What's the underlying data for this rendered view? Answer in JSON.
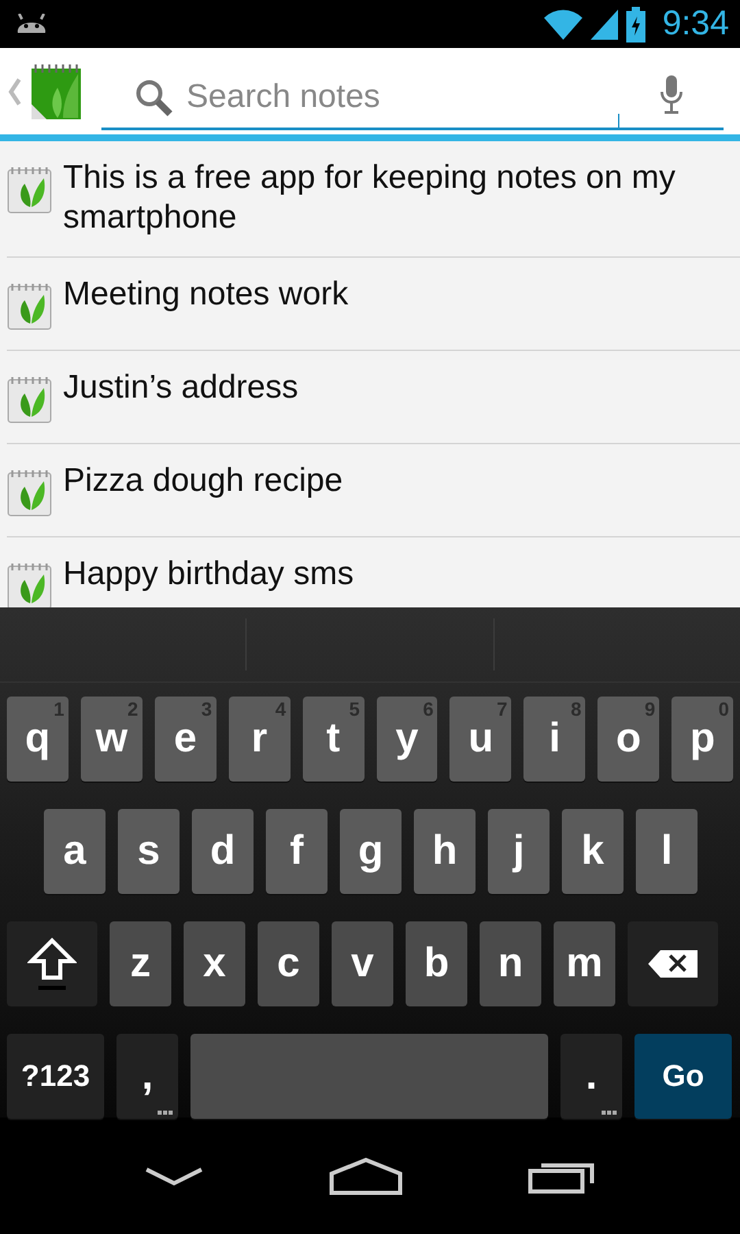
{
  "status_bar": {
    "time": "9:34"
  },
  "search": {
    "placeholder": "Search notes"
  },
  "notes": [
    {
      "title": "This is a free app for keeping notes on my smartphone"
    },
    {
      "title": "Meeting notes work"
    },
    {
      "title": "Justin’s address"
    },
    {
      "title": "Pizza dough recipe"
    },
    {
      "title": "Happy birthday sms"
    }
  ],
  "keyboard": {
    "key_rows": [
      {
        "keys": [
          {
            "kind": "letter",
            "label": "q",
            "hint": "1"
          },
          {
            "kind": "letter",
            "label": "w",
            "hint": "2"
          },
          {
            "kind": "letter",
            "label": "e",
            "hint": "3"
          },
          {
            "kind": "letter",
            "label": "r",
            "hint": "4"
          },
          {
            "kind": "letter",
            "label": "t",
            "hint": "5"
          },
          {
            "kind": "letter",
            "label": "y",
            "hint": "6"
          },
          {
            "kind": "letter",
            "label": "u",
            "hint": "7"
          },
          {
            "kind": "letter",
            "label": "i",
            "hint": "8"
          },
          {
            "kind": "letter",
            "label": "o",
            "hint": "9"
          },
          {
            "kind": "letter",
            "label": "p",
            "hint": "0"
          }
        ]
      },
      {
        "keys": [
          {
            "kind": "letter",
            "label": "a"
          },
          {
            "kind": "letter",
            "label": "s"
          },
          {
            "kind": "letter",
            "label": "d"
          },
          {
            "kind": "letter",
            "label": "f"
          },
          {
            "kind": "letter",
            "label": "g"
          },
          {
            "kind": "letter",
            "label": "h"
          },
          {
            "kind": "letter",
            "label": "j"
          },
          {
            "kind": "letter",
            "label": "k"
          },
          {
            "kind": "letter",
            "label": "l"
          }
        ]
      },
      {
        "keys": [
          {
            "kind": "shift"
          },
          {
            "kind": "letter",
            "label": "z"
          },
          {
            "kind": "letter",
            "label": "x"
          },
          {
            "kind": "letter",
            "label": "c"
          },
          {
            "kind": "letter",
            "label": "v"
          },
          {
            "kind": "letter",
            "label": "b"
          },
          {
            "kind": "letter",
            "label": "n"
          },
          {
            "kind": "letter",
            "label": "m"
          },
          {
            "kind": "delete"
          }
        ]
      },
      {
        "keys": [
          {
            "kind": "symbols",
            "label": "?123"
          },
          {
            "kind": "punct",
            "label": ",",
            "more": true
          },
          {
            "kind": "space"
          },
          {
            "kind": "punct",
            "label": ".",
            "more": true
          },
          {
            "kind": "action",
            "label": "Go"
          }
        ]
      }
    ]
  }
}
